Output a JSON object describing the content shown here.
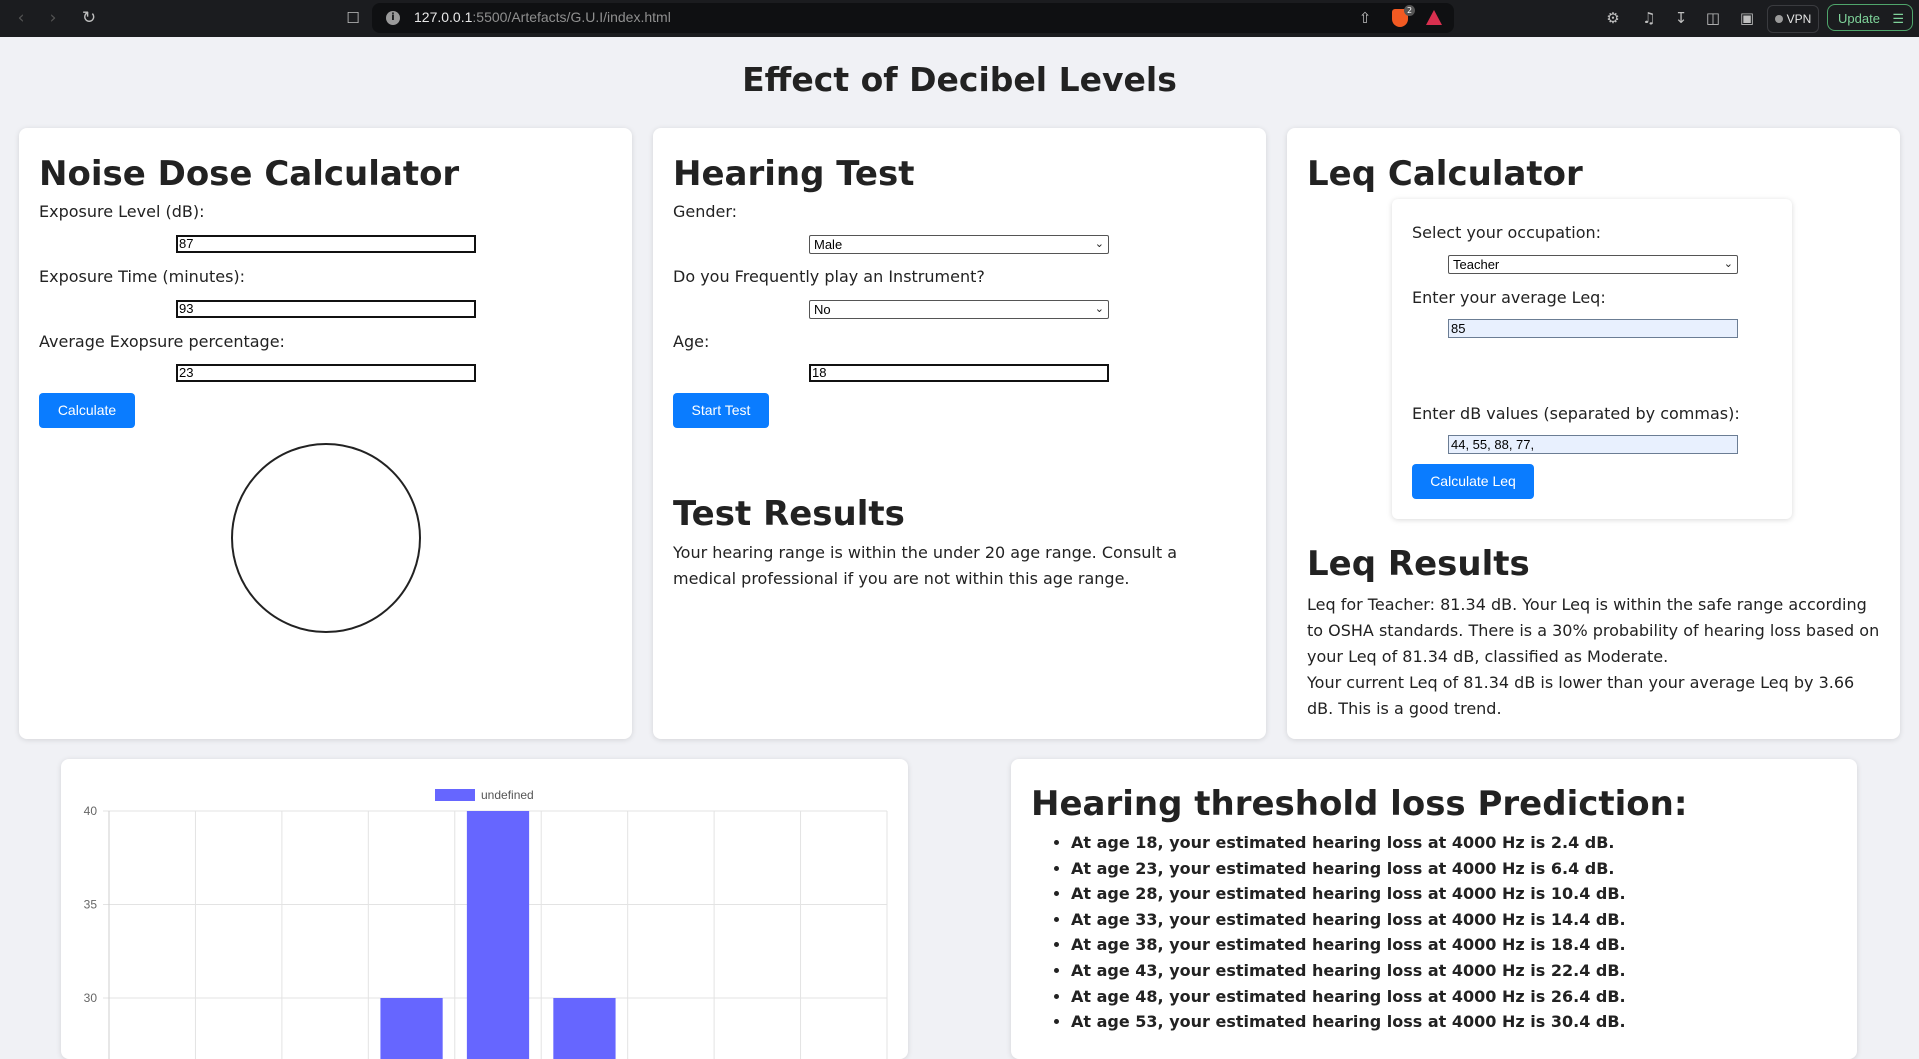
{
  "browser": {
    "url_host": "127.0.0.1",
    "url_path": ":5500/Artefacts/G.U.I/index.html",
    "vpn_label": "VPN",
    "update_label": "Update",
    "brave_badge": "2"
  },
  "page": {
    "title": "Effect of Decibel Levels"
  },
  "noise_dose": {
    "heading": "Noise Dose Calculator",
    "exposure_level_label": "Exposure Level (dB):",
    "exposure_level_value": "87",
    "exposure_time_label": "Exposure Time (minutes):",
    "exposure_time_value": "93",
    "avg_percentage_label": "Average Exopsure percentage:",
    "avg_percentage_value": "23",
    "calculate_label": "Calculate"
  },
  "hearing_test": {
    "heading": "Hearing Test",
    "gender_label": "Gender:",
    "gender_value": "Male",
    "instrument_label": "Do you Frequently play an Instrument?",
    "instrument_value": "No",
    "age_label": "Age:",
    "age_value": "18",
    "start_label": "Start Test",
    "results_heading": "Test Results",
    "results_text": "Your hearing range is within the under 20 age range. Consult a medical professional if you are not within this age range."
  },
  "leq": {
    "heading": "Leq Calculator",
    "occupation_label": "Select your occupation:",
    "occupation_value": "Teacher",
    "avg_leq_label": "Enter your average Leq:",
    "avg_leq_value": "85",
    "db_values_label": "Enter dB values (separated by commas):",
    "db_values_value": "44, 55, 88, 77,",
    "calculate_label": "Calculate Leq",
    "results_heading": "Leq Results",
    "results_line1": "Leq for Teacher: 81.34 dB. Your Leq is within the safe range according to OSHA standards. There is a 30% probability of hearing loss based on your Leq of 81.34 dB, classified as Moderate.",
    "results_line2": "Your current Leq of 81.34 dB is lower than your average Leq by 3.66 dB. This is a good trend."
  },
  "chart_data": {
    "type": "bar",
    "legend": [
      "undefined"
    ],
    "series": [
      {
        "name": "undefined",
        "values": [
          null,
          null,
          null,
          30,
          40,
          30,
          null,
          null,
          null
        ]
      }
    ],
    "y_ticks": [
      30,
      35,
      40
    ],
    "ylim_visible": [
      29,
      40
    ],
    "grid": true,
    "legend_position": "top",
    "bar_color": "#6666ff"
  },
  "prediction": {
    "heading": "Hearing threshold loss Prediction:",
    "items": [
      "At age 18, your estimated hearing loss at 4000 Hz is 2.4 dB.",
      "At age 23, your estimated hearing loss at 4000 Hz is 6.4 dB.",
      "At age 28, your estimated hearing loss at 4000 Hz is 10.4 dB.",
      "At age 33, your estimated hearing loss at 4000 Hz is 14.4 dB.",
      "At age 38, your estimated hearing loss at 4000 Hz is 18.4 dB.",
      "At age 43, your estimated hearing loss at 4000 Hz is 22.4 dB.",
      "At age 48, your estimated hearing loss at 4000 Hz is 26.4 dB.",
      "At age 53, your estimated hearing loss at 4000 Hz is 30.4 dB."
    ]
  }
}
